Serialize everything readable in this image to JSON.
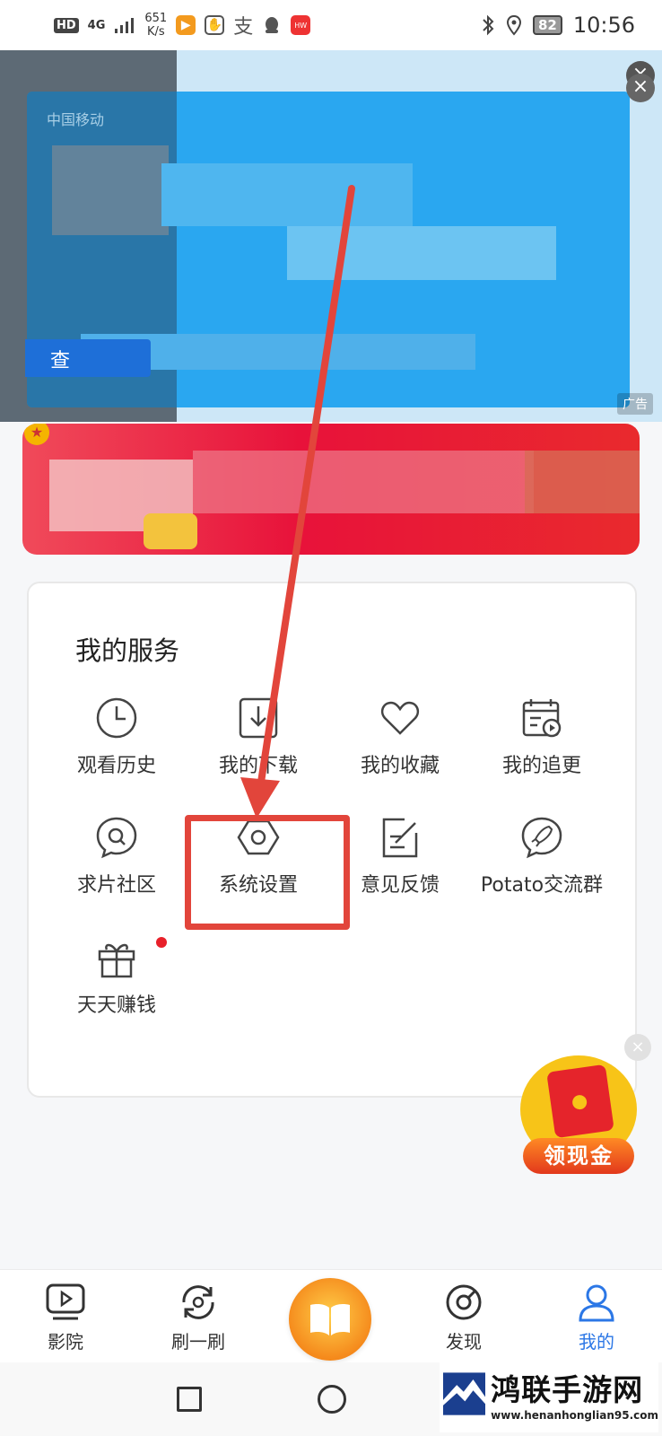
{
  "status_bar": {
    "hd": "HD",
    "network": "4G",
    "speed_value": "651",
    "speed_unit": "K/s",
    "battery": "82",
    "time": "10:56"
  },
  "ad": {
    "carrier": "中国移动",
    "query_label": "查",
    "tag": "广告",
    "close_glyph": "×"
  },
  "services": {
    "title": "我的服务",
    "items": [
      {
        "label": "观看历史",
        "icon": "clock-icon"
      },
      {
        "label": "我的下载",
        "icon": "download-icon"
      },
      {
        "label": "我的收藏",
        "icon": "heart-icon"
      },
      {
        "label": "我的追更",
        "icon": "calendar-play-icon"
      },
      {
        "label": "求片社区",
        "icon": "chat-search-icon"
      },
      {
        "label": "系统设置",
        "icon": "settings-hex-icon"
      },
      {
        "label": "意见反馈",
        "icon": "feedback-edit-icon"
      },
      {
        "label": "Potato交流群",
        "icon": "rocket-chat-icon"
      },
      {
        "label": "天天赚钱",
        "icon": "gift-icon"
      }
    ]
  },
  "cash_button": {
    "label": "领现金",
    "close_glyph": "×"
  },
  "bottom_nav": {
    "items": [
      {
        "label": "影院",
        "icon": "cinema-play-icon"
      },
      {
        "label": "刷一刷",
        "icon": "refresh-play-icon"
      },
      {
        "label": "发现",
        "icon": "compass-icon"
      },
      {
        "label": "我的",
        "icon": "user-icon",
        "active": true
      }
    ]
  },
  "watermark": {
    "title": "鸿联手游网",
    "url": "www.henanhonglian95.com"
  },
  "colors": {
    "accent_blue": "#2b77e6",
    "annotation_red": "#e2453b",
    "ad_blue": "#2aa7f0",
    "promo_red": "#e8123a"
  }
}
